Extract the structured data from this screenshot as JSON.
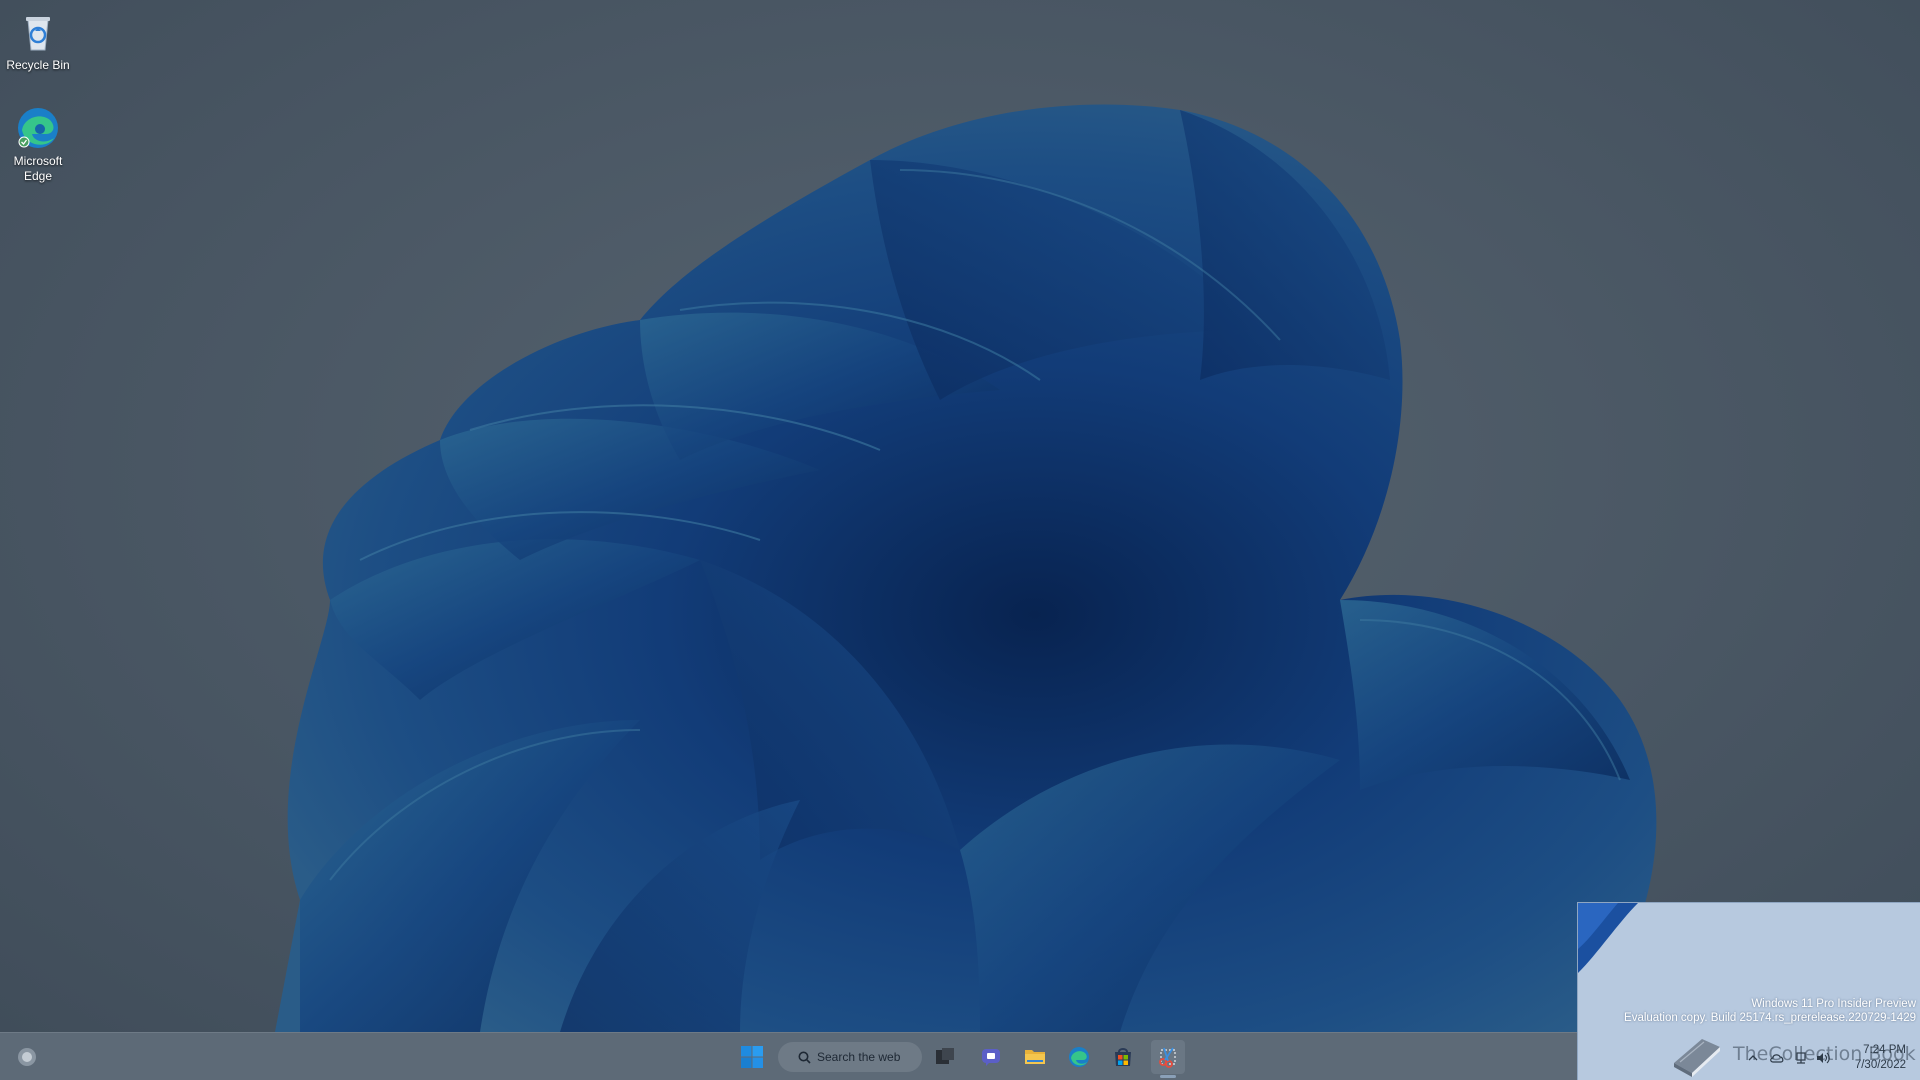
{
  "desktop": {
    "icons": [
      {
        "label": "Recycle Bin",
        "icon": "recycle-bin-icon"
      },
      {
        "label": "Microsoft Edge",
        "icon": "edge-icon"
      }
    ]
  },
  "taskbar": {
    "search_label": "Search the web",
    "apps": [
      {
        "name": "start",
        "icon": "windows-logo-icon"
      },
      {
        "name": "task-view",
        "icon": "task-view-icon"
      },
      {
        "name": "chat",
        "icon": "chat-icon"
      },
      {
        "name": "file-explorer",
        "icon": "folder-icon"
      },
      {
        "name": "edge",
        "icon": "edge-icon"
      },
      {
        "name": "store",
        "icon": "store-icon"
      },
      {
        "name": "snipping-tool",
        "icon": "snipping-tool-icon"
      }
    ]
  },
  "watermark": {
    "line1": "Windows 11 Pro Insider Preview",
    "line2": "Evaluation copy. Build 25174.rs_prerelease.220729-1429"
  },
  "brand": {
    "text": "TheCollection Book"
  },
  "tray": {
    "time": "7:24 PM",
    "date": "7/30/2022"
  },
  "colors": {
    "desktop_bg": "#4a5764",
    "bloom_dark": "#0f3470",
    "bloom_light": "#2f5f8f",
    "taskbar_bg": "#5d6a77",
    "overlay_bg": "#b7c9df"
  }
}
